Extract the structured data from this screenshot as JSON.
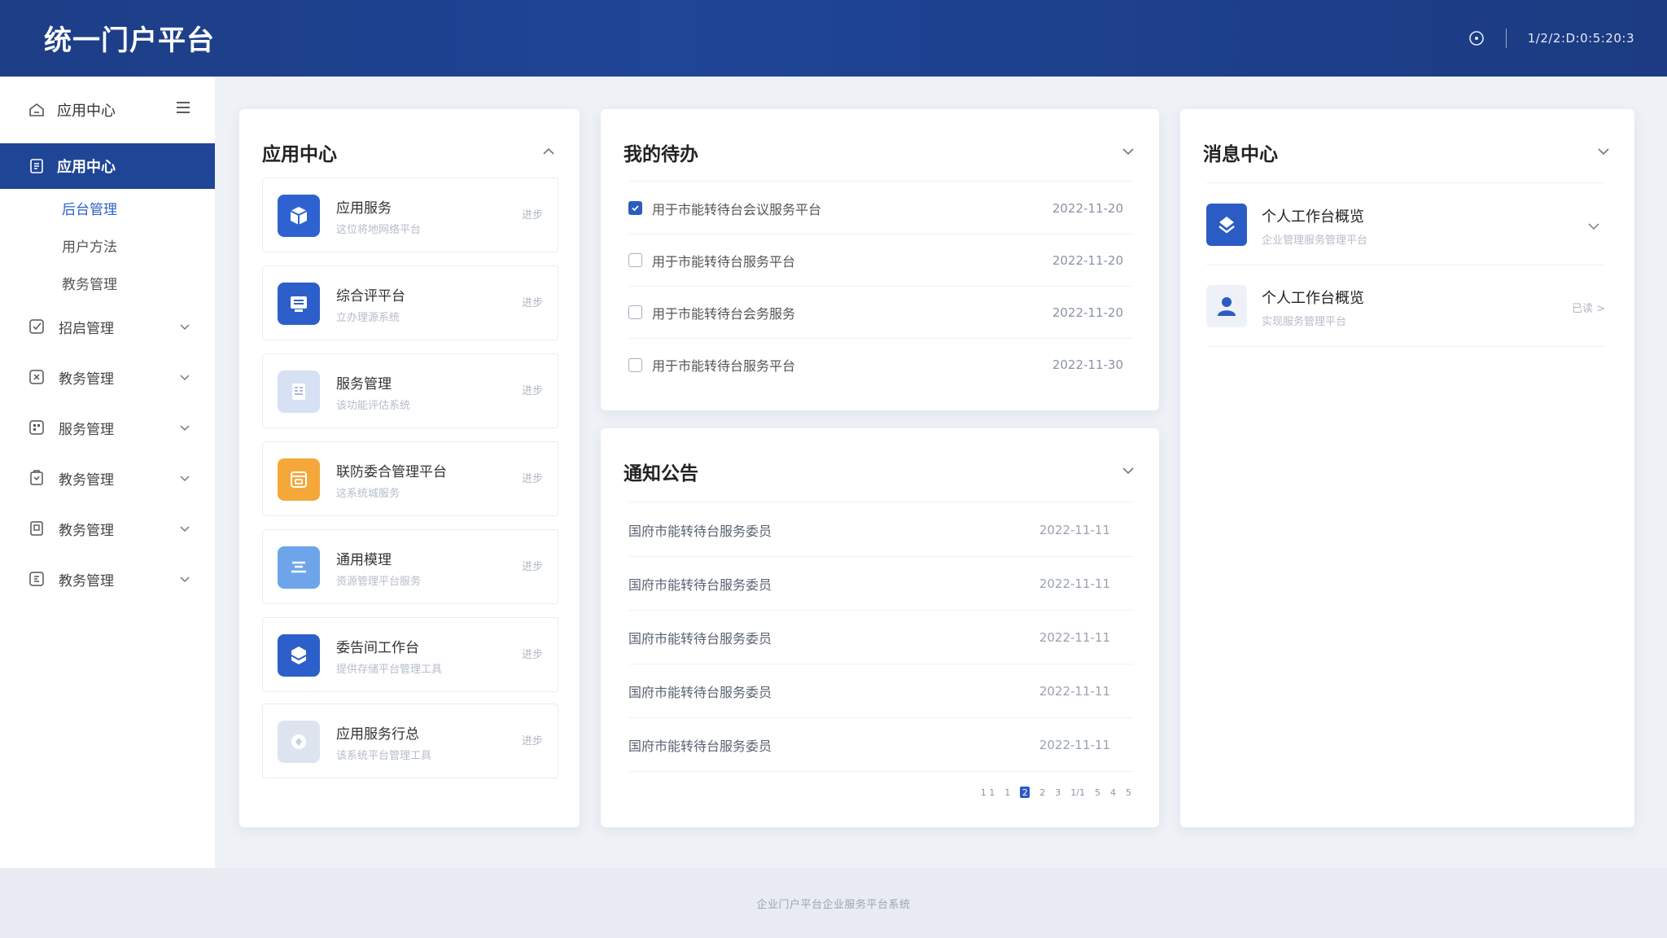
{
  "header": {
    "brand": "统一门户平台",
    "datetime": "1/2/2:D:0:5:20:3"
  },
  "sidebar": {
    "top_label": "应用中心",
    "active_label": "应用中心",
    "sub_items": [
      {
        "label": "后台管理",
        "active": true
      },
      {
        "label": "用户方法",
        "active": false
      },
      {
        "label": "教务管理",
        "active": false
      }
    ],
    "items": [
      {
        "label": "招启管理",
        "icon": "check-square-icon"
      },
      {
        "label": "教务管理",
        "icon": "x-square-icon"
      },
      {
        "label": "服务管理",
        "icon": "grid-square-icon"
      },
      {
        "label": "教务管理",
        "icon": "clipboard-icon"
      },
      {
        "label": "教务管理",
        "icon": "file-icon"
      },
      {
        "label": "教务管理",
        "icon": "doc-square-icon"
      }
    ]
  },
  "app_center": {
    "title": "应用中心",
    "apps": [
      {
        "name": "应用服务",
        "desc": "这位将地网络平台",
        "action": "进步",
        "icon": "cube-icon",
        "color": "#2f62d1"
      },
      {
        "name": "综合评平台",
        "desc": "立办理源系统",
        "action": "进步",
        "icon": "monitor-icon",
        "color": "#2c5fc9"
      },
      {
        "name": "服务管理",
        "desc": "该功能评估系统",
        "action": "进步",
        "icon": "document-icon",
        "color": "#d6e1f3"
      },
      {
        "name": "联防委合管理平台",
        "desc": "这系统城服务",
        "action": "进步",
        "icon": "calendar-icon",
        "color": "#f5a83a"
      },
      {
        "name": "通用模理",
        "desc": "资源管理平台服务",
        "action": "进步",
        "icon": "layers-icon",
        "color": "#6ea5ea"
      },
      {
        "name": "委告间工作台",
        "desc": "提供存储平台管理工具",
        "action": "进步",
        "icon": "hex-icon",
        "color": "#2c5fc9"
      },
      {
        "name": "应用服务行总",
        "desc": "该系统平台管理工具",
        "action": "进步",
        "icon": "gear-icon",
        "color": "#dde4ef"
      }
    ]
  },
  "todo": {
    "title": "我的待办",
    "items": [
      {
        "text": "用于市能转待台会议服务平台",
        "date": "2022-11-20",
        "checked": true
      },
      {
        "text": "用于市能转待台服务平台",
        "date": "2022-11-20",
        "checked": false
      },
      {
        "text": "用于市能转待台会务服务",
        "date": "2022-11-20",
        "checked": false
      },
      {
        "text": "用于市能转待台服务平台",
        "date": "2022-11-30",
        "checked": false
      }
    ]
  },
  "notices": {
    "title": "通知公告",
    "items": [
      {
        "text": "国府市能转待台服务委员",
        "date": "2022-11-11"
      },
      {
        "text": "国府市能转待台服务委员",
        "date": "2022-11-11"
      },
      {
        "text": "国府市能转待台服务委员",
        "date": "2022-11-11"
      },
      {
        "text": "国府市能转待台服务委员",
        "date": "2022-11-11"
      },
      {
        "text": "国府市能转待台服务委员",
        "date": "2022-11-11"
      }
    ],
    "pager": [
      "1 1",
      "1",
      "2",
      "2",
      "3",
      "1/1",
      "5",
      "4",
      "5"
    ],
    "pager_active_index": 2
  },
  "messages": {
    "title": "消息中心",
    "items": [
      {
        "title": "个人工作台概览",
        "desc": "企业管理服务管理平台",
        "icon": "layers-icon",
        "color": "#2a5cc4",
        "action": ""
      },
      {
        "title": "个人工作台概览",
        "desc": "实现服务管理平台",
        "icon": "user-icon",
        "color": "#eef2f8",
        "action": "已读 >"
      }
    ]
  },
  "footer": {
    "text": "企业门户平台企业服务平台系统"
  }
}
